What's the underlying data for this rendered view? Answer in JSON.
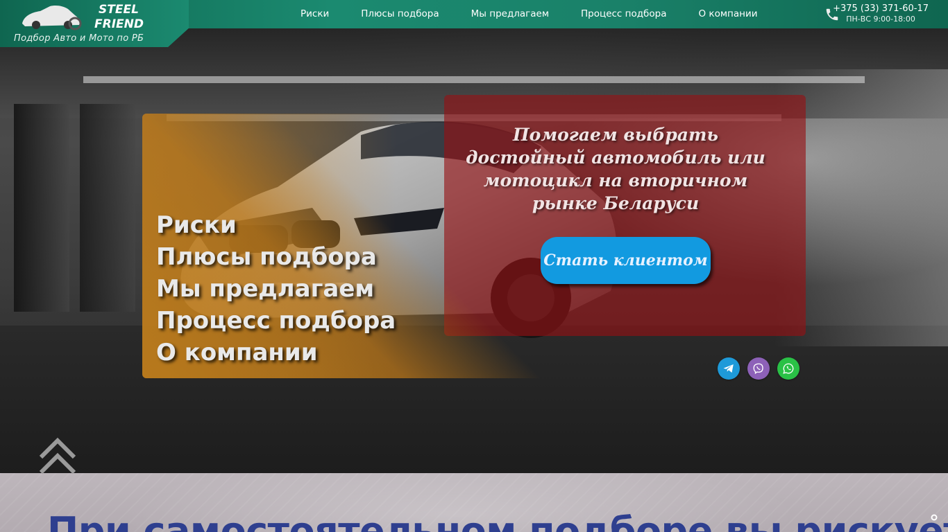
{
  "brand": {
    "name_line1": "STEEL",
    "name_line2": "FRIEND",
    "tagline": "Подбор Авто и Мото по РБ"
  },
  "nav": {
    "items": [
      {
        "label": "Риски"
      },
      {
        "label": "Плюсы подбора"
      },
      {
        "label": "Мы предлагаем"
      },
      {
        "label": "Процесс подбора"
      },
      {
        "label": "О компании"
      }
    ]
  },
  "contact": {
    "phone": "+375 (33) 371-60-17",
    "hours": "ПН-ВС 9:00-18:00",
    "icon": "phone-icon"
  },
  "hero": {
    "menu": [
      {
        "label": "Риски"
      },
      {
        "label": "Плюсы подбора"
      },
      {
        "label": "Мы предлагаем"
      },
      {
        "label": "Процесс подбора"
      },
      {
        "label": "О компании"
      }
    ],
    "slogan": "Помогаем выбрать достойный автомобиль или мотоцикл на вторичном рынке Беларуси",
    "cta_label": "Стать клиентом",
    "socials": [
      {
        "name": "telegram-icon",
        "color": "#1e9ad9"
      },
      {
        "name": "viber-icon",
        "color": "#8d61b8"
      },
      {
        "name": "whatsapp-icon",
        "color": "#2ac146"
      }
    ]
  },
  "section2": {
    "title": "При самостоятельном подборе вы рискуете"
  },
  "colors": {
    "header_green": "#1b8a70",
    "panel_red": "#96101a",
    "panel_orange": "#be7819",
    "cta_blue": "#129ae0",
    "section_title": "#2e3f8f"
  }
}
